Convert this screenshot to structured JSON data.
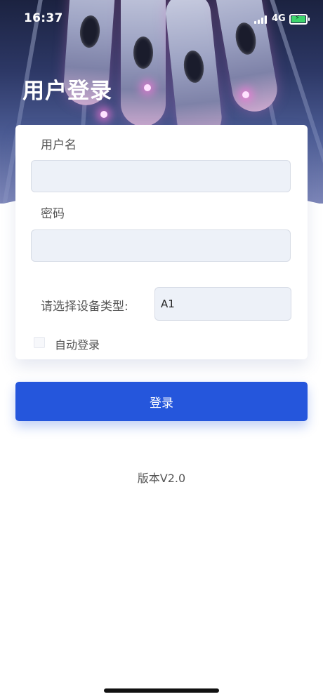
{
  "status_bar": {
    "time": "16:37",
    "network": "4G",
    "icons": [
      "signal-icon",
      "battery-charging-icon"
    ]
  },
  "header": {
    "title": "用户登录"
  },
  "form": {
    "username_label": "用户名",
    "username_value": "",
    "password_label": "密码",
    "password_value": "",
    "device_type_label": "请选择设备类型:",
    "device_type_value": "A1",
    "auto_login_label": "自动登录",
    "auto_login_checked": false
  },
  "login_button": {
    "label": "登录"
  },
  "footer": {
    "version": "版本V2.0"
  },
  "colors": {
    "primary": "#2556dc",
    "input_background": "#edf1f8",
    "text": "#555555"
  }
}
